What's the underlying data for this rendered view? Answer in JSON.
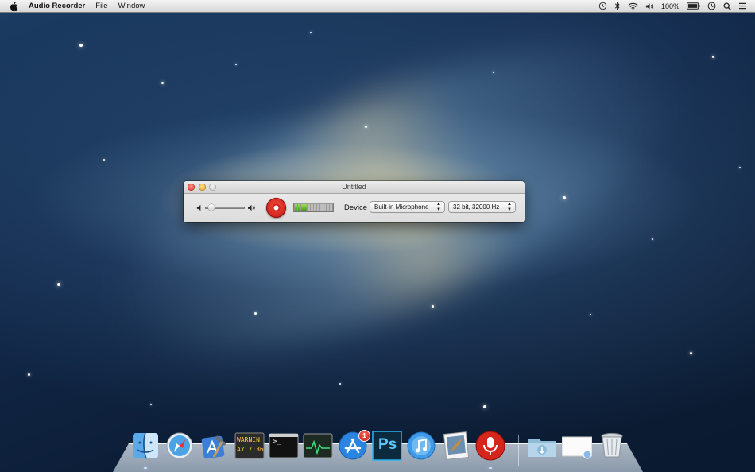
{
  "menubar": {
    "app_name": "Audio Recorder",
    "menus": [
      "File",
      "Window"
    ],
    "battery": "100%",
    "status_icons": [
      "time-machine-icon",
      "bluetooth-icon",
      "wifi-icon",
      "volume-icon",
      "battery-icon",
      "clock-icon",
      "spotlight-icon",
      "list-icon"
    ]
  },
  "window": {
    "title": "Untitled",
    "volume_level": 0.1,
    "meter_level": 0.3,
    "device_label": "Device",
    "device_value": "Built-in Microphone",
    "format_value": "32 bit, 32000 Hz"
  },
  "dock": {
    "apps": [
      "finder",
      "safari",
      "xcode",
      "console",
      "terminal",
      "activity-monitor",
      "app-store",
      "photoshop",
      "itunes",
      "preview",
      "audio-recorder"
    ],
    "stacks": [
      "downloads-folder",
      "document",
      "trash"
    ],
    "console_text": [
      "WARNIN",
      "AY 7:36"
    ],
    "terminal_prompt": ">_",
    "app_store_badge": "1",
    "photoshop_label": "Ps"
  },
  "colors": {
    "record": "#d6261c",
    "meter_green": "#6fbe33",
    "desktop": "#12294a"
  }
}
